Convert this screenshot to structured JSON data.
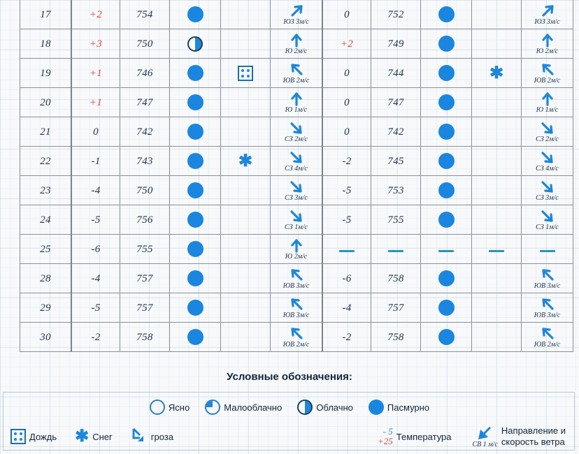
{
  "table": {
    "columns": [
      "day",
      "temperature_night",
      "pressure_night",
      "cloud_night",
      "precip_night",
      "wind_night",
      "temperature_day",
      "pressure_day",
      "cloud_day",
      "precip_day",
      "wind_day"
    ],
    "rows": [
      {
        "day": "17",
        "t1": "+2",
        "p1": "754",
        "c1": "overcast",
        "pr1": "",
        "w1dir": "ne",
        "w1": "ЮЗ 3м/с",
        "t2": "0",
        "p2": "752",
        "c2": "overcast",
        "pr2": "",
        "w2dir": "ne",
        "w2": "ЮЗ 3м/с"
      },
      {
        "day": "18",
        "t1": "+3",
        "p1": "750",
        "c1": "cloudy",
        "pr1": "",
        "w1dir": "n",
        "w1": "Ю 2м/с",
        "t2": "+2",
        "p2": "749",
        "c2": "overcast",
        "pr2": "",
        "w2dir": "n",
        "w2": "Ю 2м/с"
      },
      {
        "day": "19",
        "t1": "+1",
        "p1": "746",
        "c1": "overcast",
        "pr1": "rain",
        "w1dir": "nw",
        "w1": "ЮВ 2м/с",
        "t2": "0",
        "p2": "744",
        "c2": "overcast",
        "pr2": "snow",
        "w2dir": "nw",
        "w2": "ЮВ 2м/с"
      },
      {
        "day": "20",
        "t1": "+1",
        "p1": "747",
        "c1": "overcast",
        "pr1": "",
        "w1dir": "n",
        "w1": "Ю 1м/с",
        "t2": "0",
        "p2": "747",
        "c2": "overcast",
        "pr2": "",
        "w2dir": "n",
        "w2": "Ю 1м/с"
      },
      {
        "day": "21",
        "t1": "0",
        "p1": "742",
        "c1": "overcast",
        "pr1": "",
        "w1dir": "se",
        "w1": "СЗ 2м/с",
        "t2": "0",
        "p2": "742",
        "c2": "overcast",
        "pr2": "",
        "w2dir": "se",
        "w2": "СЗ 2м/с"
      },
      {
        "day": "22",
        "t1": "-1",
        "p1": "743",
        "c1": "overcast",
        "pr1": "snow",
        "w1dir": "se",
        "w1": "СЗ 4м/с",
        "t2": "-2",
        "p2": "745",
        "c2": "overcast",
        "pr2": "",
        "w2dir": "se",
        "w2": "СЗ 4м/с"
      },
      {
        "day": "23",
        "t1": "-4",
        "p1": "750",
        "c1": "overcast",
        "pr1": "",
        "w1dir": "se",
        "w1": "СЗ 3м/с",
        "t2": "-5",
        "p2": "753",
        "c2": "overcast",
        "pr2": "",
        "w2dir": "se",
        "w2": "СЗ 3м/с"
      },
      {
        "day": "24",
        "t1": "-5",
        "p1": "756",
        "c1": "overcast",
        "pr1": "",
        "w1dir": "se",
        "w1": "СЗ 1м/с",
        "t2": "-5",
        "p2": "755",
        "c2": "overcast",
        "pr2": "",
        "w2dir": "se",
        "w2": "СЗ 1м/с"
      },
      {
        "day": "25",
        "t1": "-6",
        "p1": "755",
        "c1": "overcast",
        "pr1": "",
        "w1dir": "n",
        "w1": "Ю 2м/с",
        "t2": "—",
        "p2": "—",
        "c2": "dash",
        "pr2": "dash",
        "w2dir": "dash",
        "w2": ""
      },
      {
        "day": "28",
        "t1": "-4",
        "p1": "757",
        "c1": "overcast",
        "pr1": "",
        "w1dir": "nw",
        "w1": "ЮВ 3м/с",
        "t2": "-6",
        "p2": "758",
        "c2": "overcast",
        "pr2": "",
        "w2dir": "nw",
        "w2": "ЮВ 3м/с"
      },
      {
        "day": "29",
        "t1": "-5",
        "p1": "757",
        "c1": "overcast",
        "pr1": "",
        "w1dir": "nw",
        "w1": "ЮВ 3м/с",
        "t2": "-4",
        "p2": "757",
        "c2": "overcast",
        "pr2": "",
        "w2dir": "nw",
        "w2": "ЮВ 3м/с"
      },
      {
        "day": "30",
        "t1": "-2",
        "p1": "758",
        "c1": "overcast",
        "pr1": "",
        "w1dir": "nw",
        "w1": "ЮВ 2м/с",
        "t2": "-2",
        "p2": "758",
        "c2": "overcast",
        "pr2": "",
        "w2dir": "nw",
        "w2": "ЮВ 2м/с"
      }
    ]
  },
  "legend": {
    "title": "Условные обозначения:",
    "cloud_items": [
      {
        "icon": "clear-icon",
        "label": "Ясно"
      },
      {
        "icon": "partly-cloudy-icon",
        "label": "Малооблачно"
      },
      {
        "icon": "cloudy-icon",
        "label": "Облачно"
      },
      {
        "icon": "overcast-icon",
        "label": "Пасмурно"
      }
    ],
    "precip_items": [
      {
        "icon": "rain-icon",
        "label": "Дождь"
      },
      {
        "icon": "snow-icon",
        "label": "Снег"
      },
      {
        "icon": "thunderstorm-icon",
        "label": "гроза"
      }
    ],
    "temperature": {
      "cold": "- 5",
      "warm": "+25",
      "label": "Температура"
    },
    "wind": {
      "value": "СВ 1 м/с",
      "label_line1": "Направление и",
      "label_line2": "скорость ветра"
    }
  },
  "colors": {
    "accent_blue": "#1a86e0",
    "warm_red": "#e2443b",
    "cold_blue": "#2f7fd0",
    "text": "#20344f",
    "grid": "#8a9099"
  }
}
